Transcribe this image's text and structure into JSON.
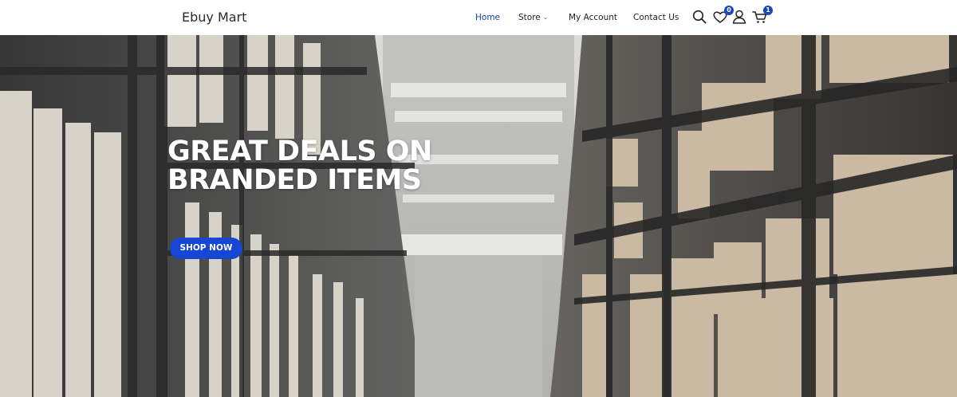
{
  "brand": {
    "name": "Ebuy Mart"
  },
  "nav": {
    "items": [
      {
        "label": "Home",
        "active": true
      },
      {
        "label": "Store",
        "has_dropdown": true
      },
      {
        "label": "My Account"
      },
      {
        "label": "Contact Us"
      }
    ]
  },
  "header_icons": {
    "search": {
      "icon": "search-icon"
    },
    "wishlist": {
      "icon": "heart-icon",
      "count": "0"
    },
    "account": {
      "icon": "user-icon"
    },
    "cart": {
      "icon": "cart-icon",
      "count": "1"
    }
  },
  "hero": {
    "title_line1": "GREAT DEALS ON",
    "title_line2": "BRANDED ITEMS",
    "cta_label": "SHOP NOW",
    "background": "warehouse-shelves-photo"
  },
  "colors": {
    "accent": "#1a48b8",
    "cta": "#1546d4",
    "header_bg": "#ffffff"
  }
}
